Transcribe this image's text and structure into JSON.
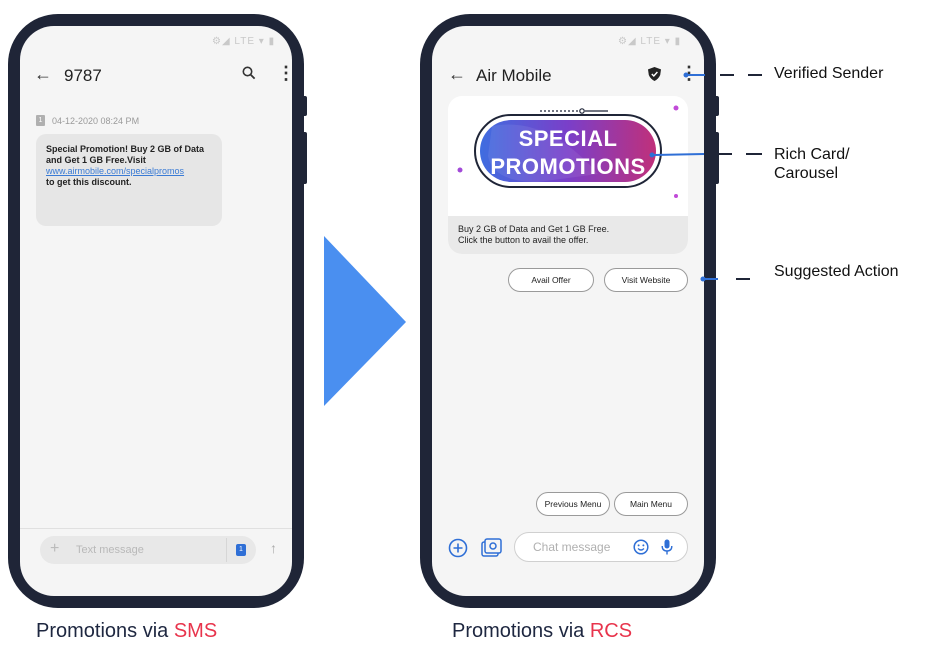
{
  "sms_phone": {
    "title": "9787",
    "status_icons": "⚙◢ LTE ▾ ▮",
    "date": "04-12-2020 08:24 PM",
    "message_line1": "Special Promotion! Buy 2 GB of Data",
    "message_line2": "and Get 1 GB Free.Visit",
    "message_link": "www.airmobile.com/specialpromos",
    "message_line3": "to get this discount.",
    "compose_placeholder": "Text message",
    "sim_label": "1"
  },
  "rcs_phone": {
    "title": "Air Mobile",
    "status_icons": "⚙◢ LTE ▾ ▮",
    "promo_line1": "SPECIAL",
    "promo_line2": "PROMOTIONS",
    "card_text_line1": "Buy 2 GB of Data and Get 1 GB Free.",
    "card_text_line2": "Click the button to avail the offer.",
    "chip_avail": "Avail Offer",
    "chip_visit": "Visit Website",
    "chip_previous": "Previous Menu",
    "chip_main": "Main Menu",
    "compose_placeholder": "Chat message"
  },
  "callouts": {
    "verified": "Verified Sender",
    "rich_card_line1": "Rich Card/",
    "rich_card_line2": "Carousel",
    "suggested": "Suggested Action"
  },
  "captions": {
    "sms_prefix": "Promotions via ",
    "sms_accent": "SMS",
    "rcs_prefix": "Promotions via ",
    "rcs_accent": "RCS"
  },
  "colors": {
    "phone_frame": "#1f2537",
    "arrow": "#4a8ff0",
    "accent_red": "#e8344c",
    "link_blue": "#3a7bd5",
    "callout_line": "#2f6fd6"
  }
}
